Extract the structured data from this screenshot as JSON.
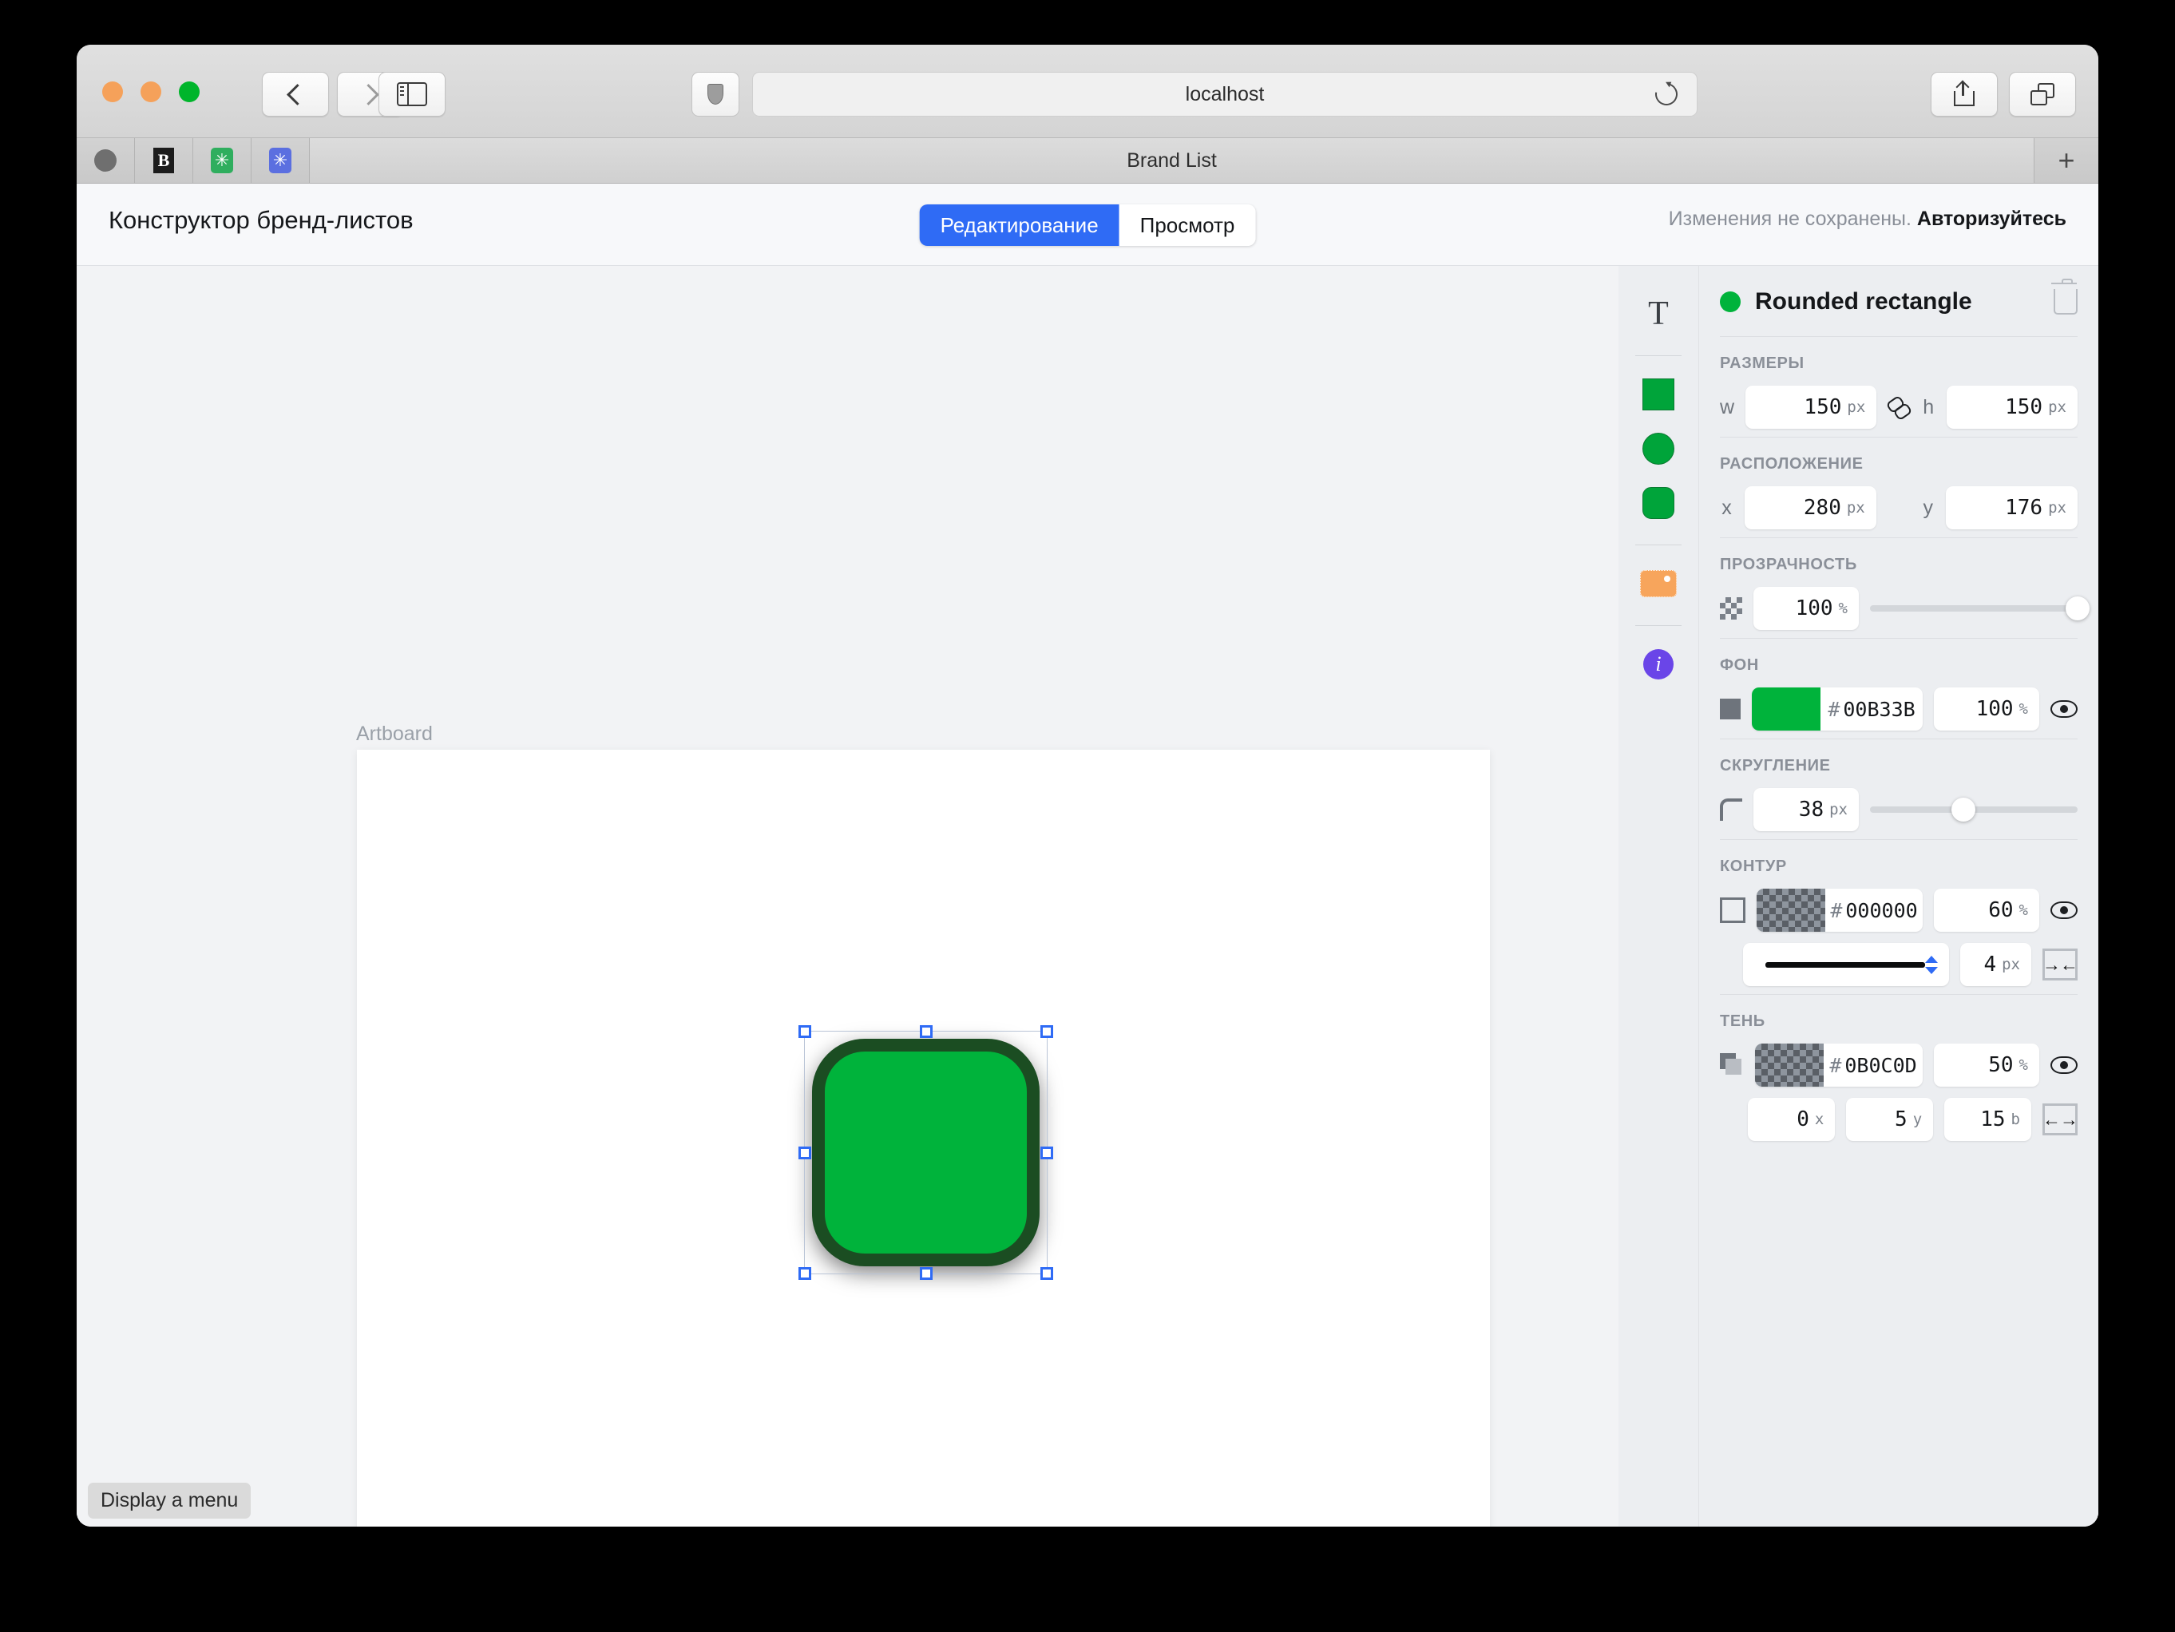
{
  "browser": {
    "url": "localhost",
    "tab_title": "Brand List",
    "new_tab_label": "+",
    "back_icon": "chevron-left-icon",
    "forward_icon": "chevron-right-icon",
    "sidebar_icon": "sidebar-icon",
    "shield_icon": "shield-icon",
    "reload_icon": "reload-icon",
    "share_icon": "share-icon",
    "tabs_icon": "tab-overview-icon",
    "favicons": [
      "circle-favicon",
      "b-favicon",
      "green-star-favicon",
      "blue-star-favicon"
    ]
  },
  "app": {
    "title": "Конструктор бренд-листов",
    "segmented": {
      "edit_label": "Редактирование",
      "view_label": "Просмотр",
      "active": "Редактирование"
    },
    "status": {
      "message": "Изменения не сохранены.",
      "action": "Авторизуйтесь"
    },
    "status_tip": "Display a menu"
  },
  "canvas": {
    "artboard_label": "Artboard",
    "shape": {
      "fill": "#00B33B",
      "stroke": "#1B4D22",
      "corner_radius": 38
    }
  },
  "rail": {
    "items": [
      {
        "name": "text-tool",
        "icon": "text-T-icon",
        "glyph": "T"
      },
      {
        "name": "square-tool",
        "icon": "square-icon"
      },
      {
        "name": "circle-tool",
        "icon": "circle-icon"
      },
      {
        "name": "rounded-rect-tool",
        "icon": "rounded-rect-icon"
      },
      {
        "name": "image-tool",
        "icon": "image-icon"
      },
      {
        "name": "info-tool",
        "icon": "info-icon",
        "glyph": "i"
      }
    ]
  },
  "inspector": {
    "title": "Rounded rectangle",
    "title_color": "#00B33B",
    "delete_icon": "trash-icon",
    "sizes": {
      "label": "РАЗМЕРЫ",
      "w_label": "w",
      "w_value": "150",
      "w_unit": "px",
      "h_label": "h",
      "h_value": "150",
      "h_unit": "px",
      "link_icon": "broken-link-icon"
    },
    "position": {
      "label": "РАСПОЛОЖЕНИЕ",
      "x_label": "x",
      "x_value": "280",
      "x_unit": "px",
      "y_label": "y",
      "y_value": "176",
      "y_unit": "px"
    },
    "opacity": {
      "label": "ПРОЗРАЧНОСТЬ",
      "icon": "checkerboard-icon",
      "value": "100",
      "unit": "%",
      "slider_percent": 100
    },
    "fill": {
      "label": "ФОН",
      "icon": "filled-square-icon",
      "color": "00B33B",
      "hash": "#",
      "opacity": "100",
      "opacity_unit": "%",
      "visibility_icon": "eye-icon"
    },
    "radius": {
      "label": "СКРУГЛЕНИЕ",
      "icon": "corner-radius-icon",
      "value": "38",
      "unit": "px",
      "slider_percent": 45
    },
    "stroke": {
      "label": "КОНТУР",
      "icon": "outline-square-icon",
      "color": "000000",
      "hash": "#",
      "opacity": "60",
      "opacity_unit": "%",
      "visibility_icon": "eye-icon",
      "style_icon": "solid-line-icon",
      "stepper_icon": "stepper-icon",
      "width": "4",
      "width_unit": "px",
      "align_icon": "inner-align-icon",
      "align_glyph": "→←"
    },
    "shadow": {
      "label": "ТЕНЬ",
      "icon": "stacked-square-icon",
      "color": "0B0C0D",
      "hash": "#",
      "opacity": "50",
      "opacity_unit": "%",
      "visibility_icon": "eye-icon",
      "x": "0",
      "x_unit": "x",
      "y": "5",
      "y_unit": "y",
      "blur": "15",
      "blur_unit": "b",
      "spread_icon": "spread-icon",
      "spread_glyph": "←→"
    }
  }
}
